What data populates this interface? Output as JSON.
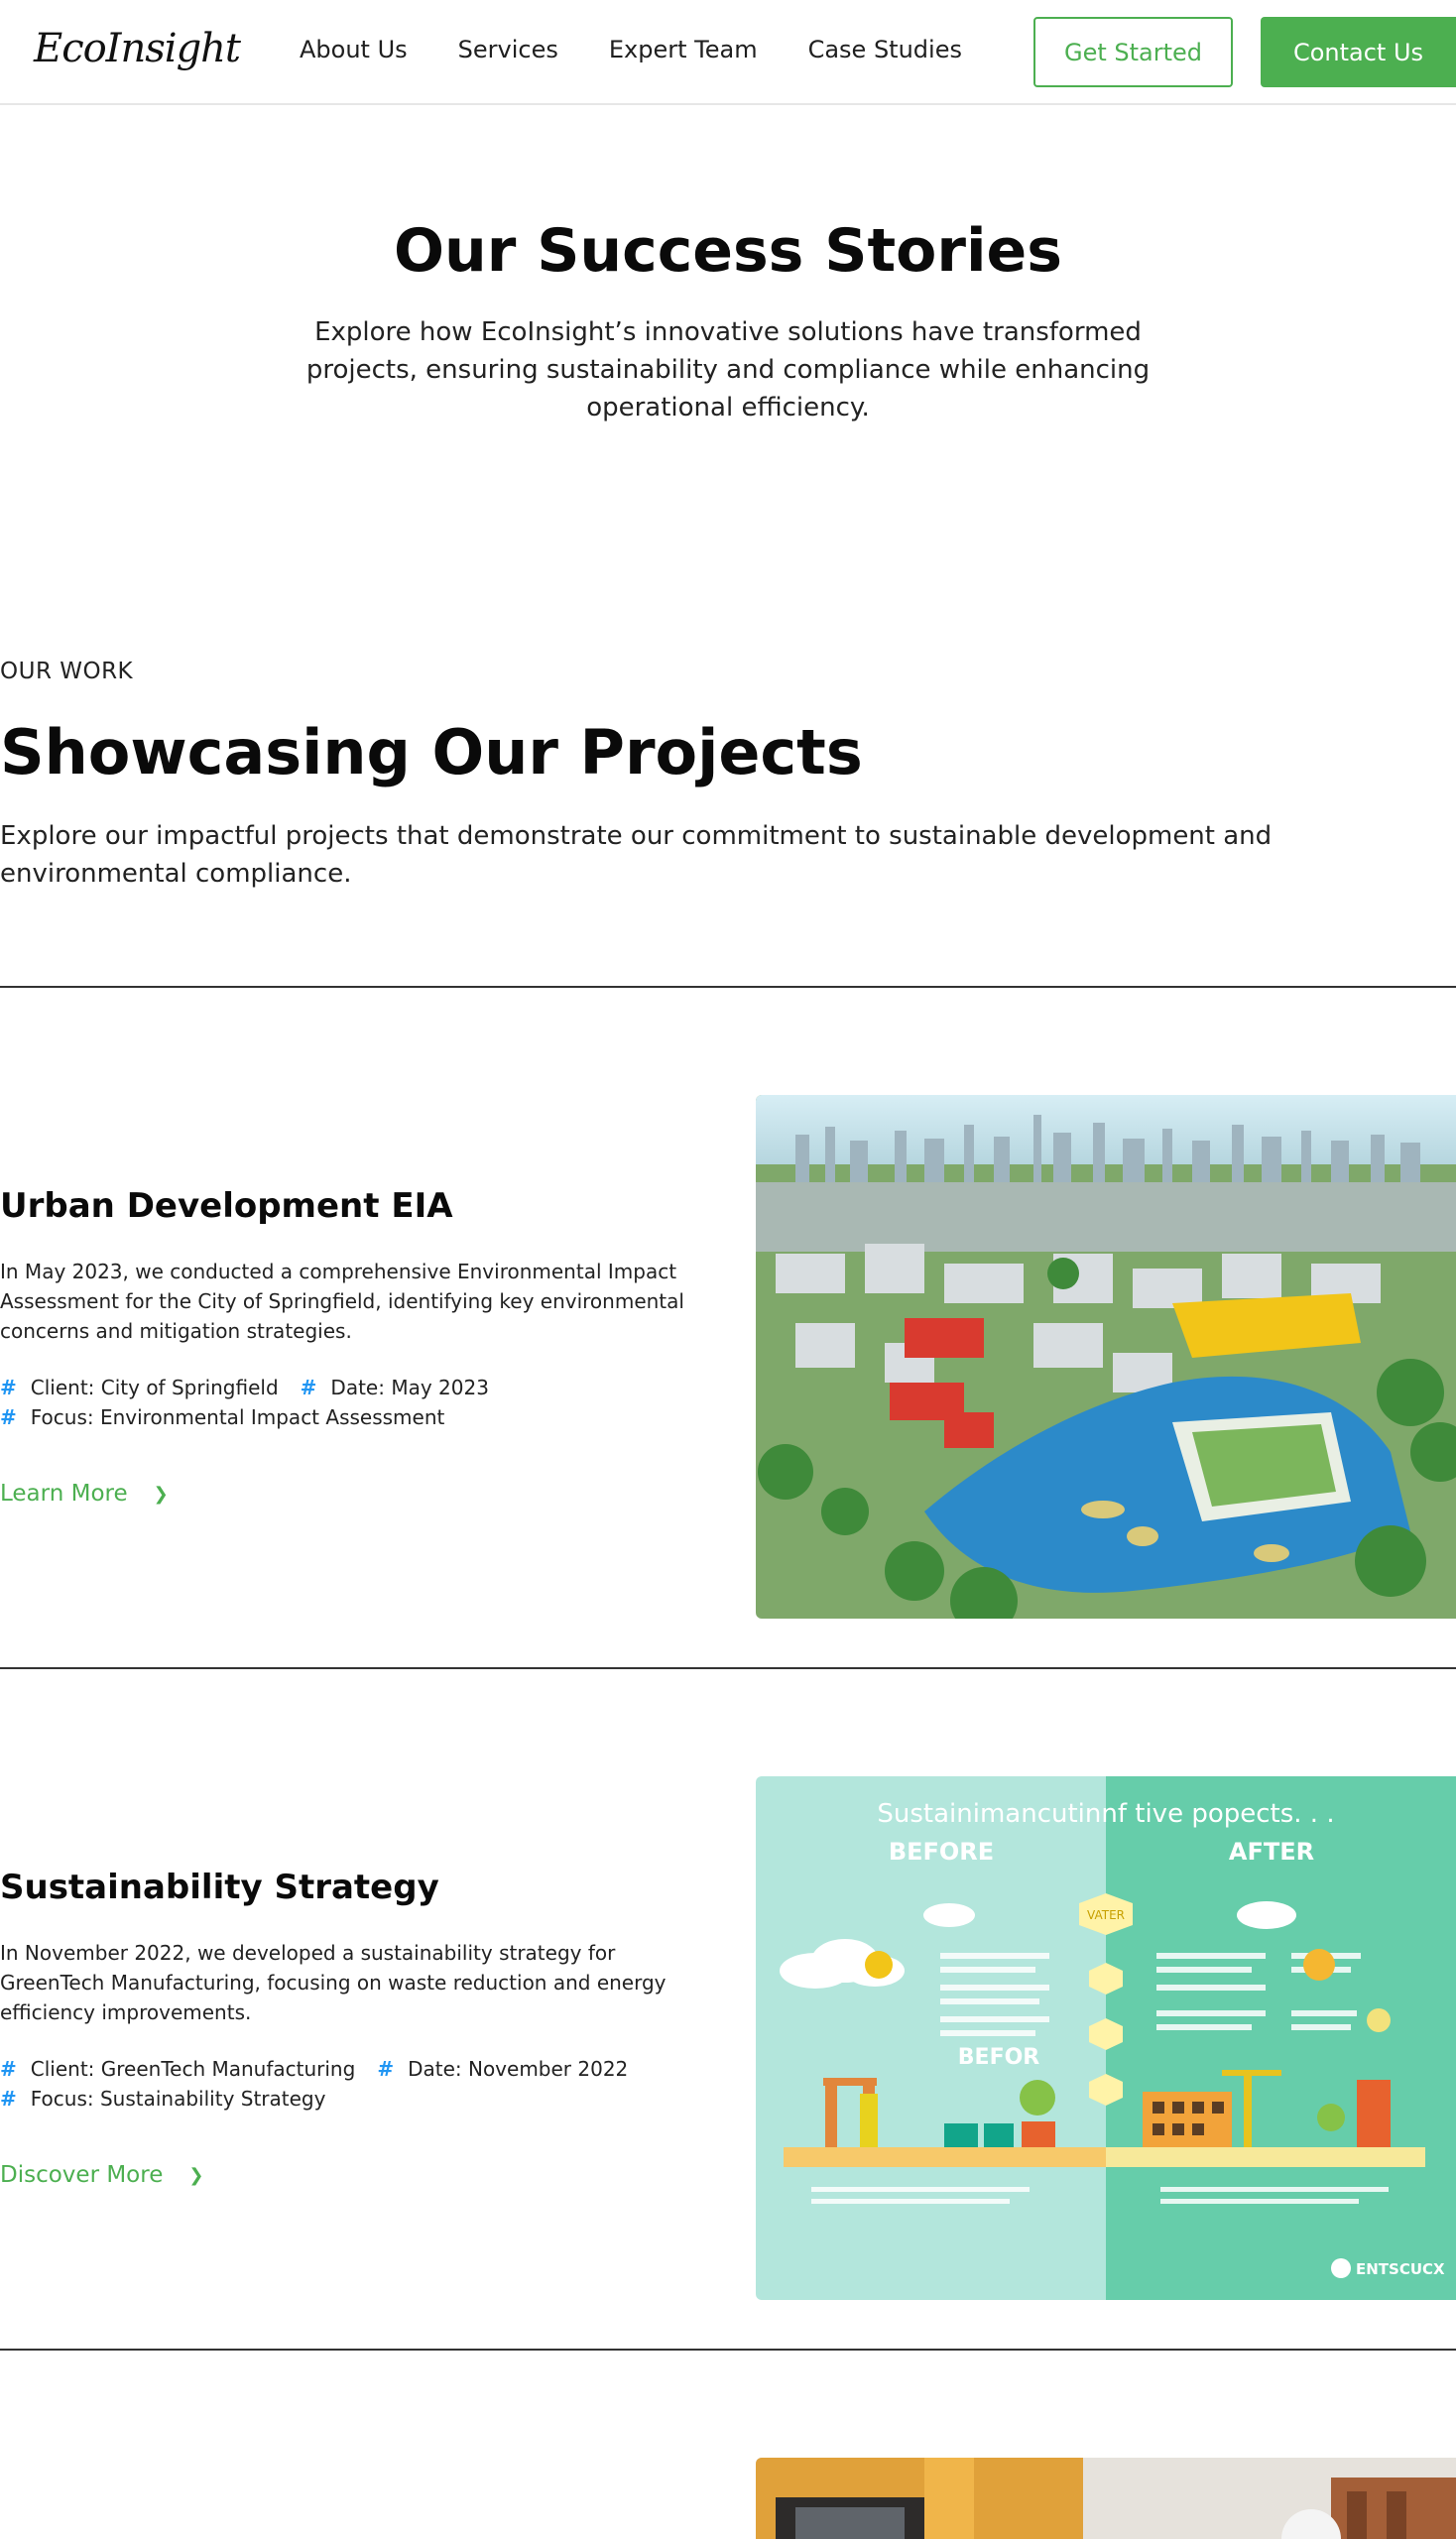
{
  "header": {
    "logo": "EcoInsight",
    "nav": [
      "About Us",
      "Services",
      "Expert Team",
      "Case Studies"
    ],
    "get_started": "Get Started",
    "contact": "Contact Us"
  },
  "hero": {
    "title": "Our Success Stories",
    "subtitle": "Explore how EcoInsight’s innovative solutions have transformed projects, ensuring sustainability and compliance while enhancing operational efficiency."
  },
  "work": {
    "eyebrow": "OUR WORK",
    "title": "Showcasing Our Projects",
    "description": "Explore our impactful projects that demonstrate our commitment to sustainable development and environmental compliance."
  },
  "projects": [
    {
      "title": "Urban Development EIA",
      "description": "In May 2023, we conducted a comprehensive Environmental Impact Assessment for the City of Springfield, identifying key environmental concerns and mitigation strategies.",
      "client": "Client: City of Springfield",
      "date": "Date: May 2023",
      "focus": "Focus: Environmental Impact Assessment",
      "cta": "Learn More"
    },
    {
      "title": "Sustainability Strategy",
      "description": "In November 2022, we developed a sustainability strategy for GreenTech Manufacturing, focusing on waste reduction and energy efficiency improvements.",
      "client": "Client: GreenTech Manufacturing",
      "date": "Date: November 2022",
      "focus": "Focus: Sustainability Strategy",
      "cta": "Discover More"
    }
  ],
  "infographic": {
    "heading": "Sustainimancutinnf tive popects. . .",
    "before": "BEFORE",
    "after": "AFTER",
    "water": "VATER",
    "mid_label": "BEFOR",
    "brand": "ENTSCUCX"
  },
  "icons": {
    "meta": "hash-icon",
    "cta": "chevron-right-icon"
  },
  "colors": {
    "accent": "#4caf50",
    "meta_icon": "#2196f3"
  }
}
